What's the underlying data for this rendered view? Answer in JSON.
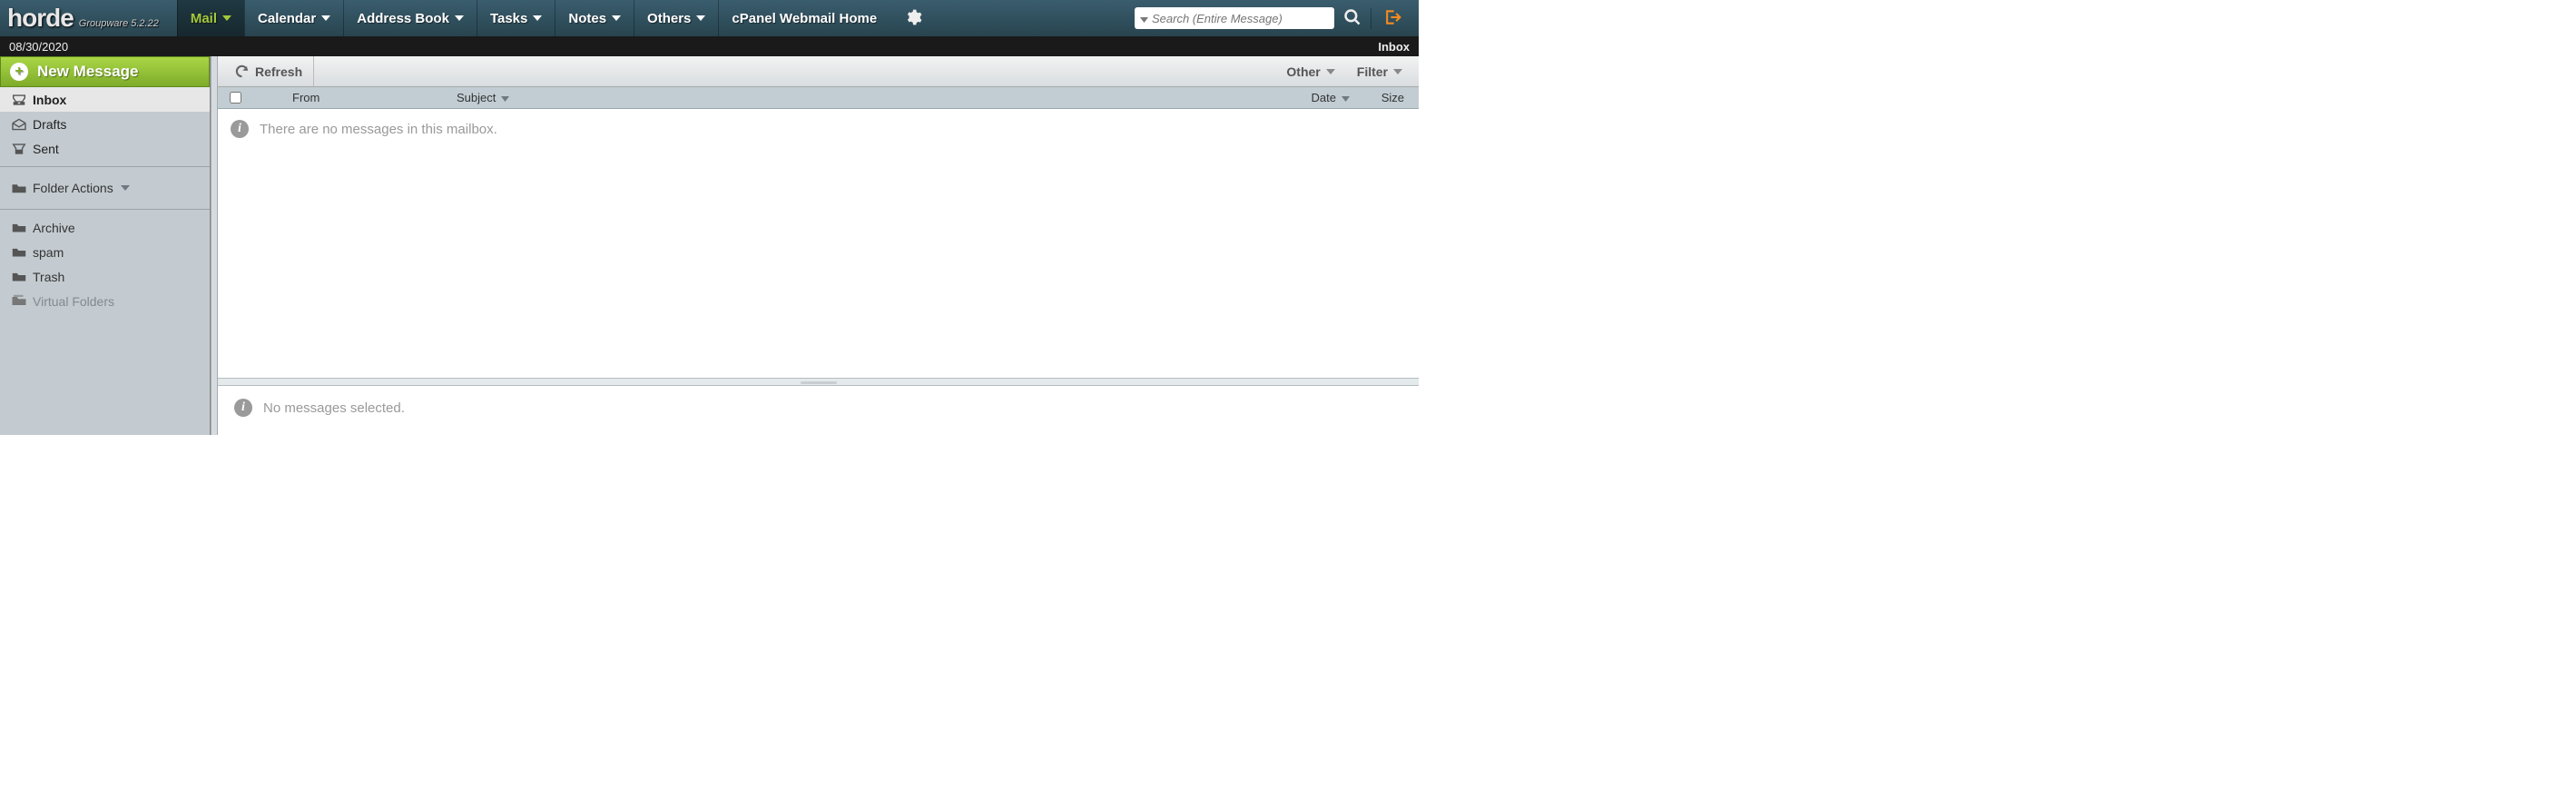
{
  "brand": {
    "name": "horde",
    "tagline": "Groupware 5.2.22"
  },
  "nav": {
    "items": [
      {
        "label": "Mail",
        "active": true,
        "dropdown": true
      },
      {
        "label": "Calendar",
        "active": false,
        "dropdown": true
      },
      {
        "label": "Address Book",
        "active": false,
        "dropdown": true
      },
      {
        "label": "Tasks",
        "active": false,
        "dropdown": true
      },
      {
        "label": "Notes",
        "active": false,
        "dropdown": true
      },
      {
        "label": "Others",
        "active": false,
        "dropdown": true
      },
      {
        "label": "cPanel Webmail Home",
        "active": false,
        "dropdown": false
      }
    ]
  },
  "search": {
    "placeholder": "Search (Entire Message)"
  },
  "datebar": {
    "date": "08/30/2020",
    "mailbox": "Inbox"
  },
  "sidebar": {
    "new_message": "New Message",
    "primary": [
      {
        "label": "Inbox",
        "icon": "inbox-icon",
        "selected": true
      },
      {
        "label": "Drafts",
        "icon": "drafts-icon",
        "selected": false
      },
      {
        "label": "Sent",
        "icon": "sent-icon",
        "selected": false
      }
    ],
    "folder_actions_label": "Folder Actions",
    "secondary": [
      {
        "label": "Archive",
        "icon": "folder-icon",
        "muted": false
      },
      {
        "label": "spam",
        "icon": "folder-icon",
        "muted": false
      },
      {
        "label": "Trash",
        "icon": "folder-icon",
        "muted": false
      },
      {
        "label": "Virtual Folders",
        "icon": "virtual-folder-icon",
        "muted": true
      }
    ]
  },
  "toolbar": {
    "refresh": "Refresh",
    "other": "Other",
    "filter": "Filter"
  },
  "columns": {
    "from": "From",
    "subject": "Subject",
    "date": "Date",
    "size": "Size"
  },
  "messages": {
    "empty_list": "There are no messages in this mailbox.",
    "none_selected": "No messages selected."
  }
}
